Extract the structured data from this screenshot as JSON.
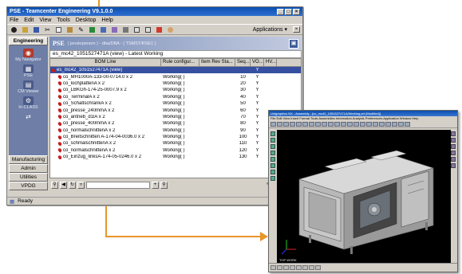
{
  "window": {
    "title": "PSE - Teamcenter Engineering V9.1.0.0",
    "menu": [
      "File",
      "Edit",
      "View",
      "Tools",
      "Desktop",
      "Help"
    ],
    "applications_label": "Applications"
  },
  "nav": {
    "tab_engineering": "Engineering",
    "items": [
      {
        "label": "My Navigator",
        "icon": "navigator-icon"
      },
      {
        "label": "PSE",
        "icon": "pse-icon"
      },
      {
        "label": "CM Viewer",
        "icon": "cm-viewer-icon"
      },
      {
        "label": "In-CLASS",
        "icon": "in-class-icon"
      },
      {
        "label": "",
        "icon": "connector-icon"
      }
    ],
    "bottom_tabs": [
      "Manufacturing",
      "Admin",
      "Utilities",
      "VPDG"
    ]
  },
  "pse": {
    "logo": "PSE",
    "subtitle": "( jenskrpersen ) - dba/DBA - ( TSMST/RSE1 )"
  },
  "bom": {
    "window_title": "es_mc42_1051527471A (view) - Latest Working",
    "columns": [
      "BOM Line",
      "Rule configur...",
      "Item Rev Sta...",
      "Seq...",
      "VO...",
      "HV..."
    ],
    "rows": [
      {
        "line": "es_mc42_1051527471A (view)",
        "rule": "",
        "status": "",
        "seq": "",
        "vo": "Y",
        "hv": "",
        "selected": true,
        "indent": 0
      },
      {
        "line": "co_MH1000A-133-00-0714.0 x 2",
        "rule": "Working( )",
        "status": "",
        "seq": "10",
        "vo": "Y",
        "hv": "",
        "selected": false,
        "indent": 1
      },
      {
        "line": "co_lochplattenA x 2",
        "rule": "Working( )",
        "status": "",
        "seq": "20",
        "vo": "Y",
        "hv": "",
        "selected": false,
        "indent": 1
      },
      {
        "line": "co_LBKGh-174-25-0007.9 x 2",
        "rule": "Working( )",
        "status": "",
        "seq": "30",
        "vo": "Y",
        "hv": "",
        "selected": false,
        "indent": 1
      },
      {
        "line": "co_TerminalA x 2",
        "rule": "Working( )",
        "status": "",
        "seq": "40",
        "vo": "Y",
        "hv": "",
        "selected": false,
        "indent": 1
      },
      {
        "line": "co_SchaltschrankA x 2",
        "rule": "Working( )",
        "status": "",
        "seq": "50",
        "vo": "Y",
        "hv": "",
        "selected": false,
        "indent": 1
      },
      {
        "line": "co_presse_240mmA x 2",
        "rule": "Working( )",
        "status": "",
        "seq": "60",
        "vo": "Y",
        "hv": "",
        "selected": false,
        "indent": 1
      },
      {
        "line": "co_antrieb_d1lA x 2",
        "rule": "Working( )",
        "status": "",
        "seq": "70",
        "vo": "Y",
        "hv": "",
        "selected": false,
        "indent": 1
      },
      {
        "line": "co_presse_400mmA x 2",
        "rule": "Working( )",
        "status": "",
        "seq": "80",
        "vo": "Y",
        "hv": "",
        "selected": false,
        "indent": 1
      },
      {
        "line": "co_normalschnittenA x 2",
        "rule": "Working( )",
        "status": "",
        "seq": "90",
        "vo": "Y",
        "hv": "",
        "selected": false,
        "indent": 1
      },
      {
        "line": "co_Breitschnitten A-174-04-0036.0 x 2",
        "rule": "Working( )",
        "status": "",
        "seq": "100",
        "vo": "Y",
        "hv": "",
        "selected": false,
        "indent": 1
      },
      {
        "line": "co_schmalschnittenA x 2",
        "rule": "Working( )",
        "status": "",
        "seq": "110",
        "vo": "Y",
        "hv": "",
        "selected": false,
        "indent": 1
      },
      {
        "line": "co_normalschnittenA x 2",
        "rule": "Working( )",
        "status": "",
        "seq": "120",
        "vo": "Y",
        "hv": "",
        "selected": false,
        "indent": 1
      },
      {
        "line": "co_Einzug_linksA-174-05-0246.0 x 2",
        "rule": "Working( )",
        "status": "",
        "seq": "130",
        "vo": "Y",
        "hv": "",
        "selected": false,
        "indent": 1
      }
    ]
  },
  "status": {
    "text": "Ready"
  },
  "cad": {
    "title": "Unigraphics NX - Assembly - [co_mc42_1051527471A/Working.prt (Modified)]",
    "menu": "File Edit View Insert Format Tools Assemblies Information Analysis Preferences Application Window Help",
    "viewport_label": "TOP WORK"
  },
  "colors": {
    "accent_arrow": "#e8952a",
    "title_bar": "#0a4fb0",
    "nav_panel": "#6e7ea6",
    "selected_row": "#3550a0",
    "part_pin": "#c62020"
  }
}
